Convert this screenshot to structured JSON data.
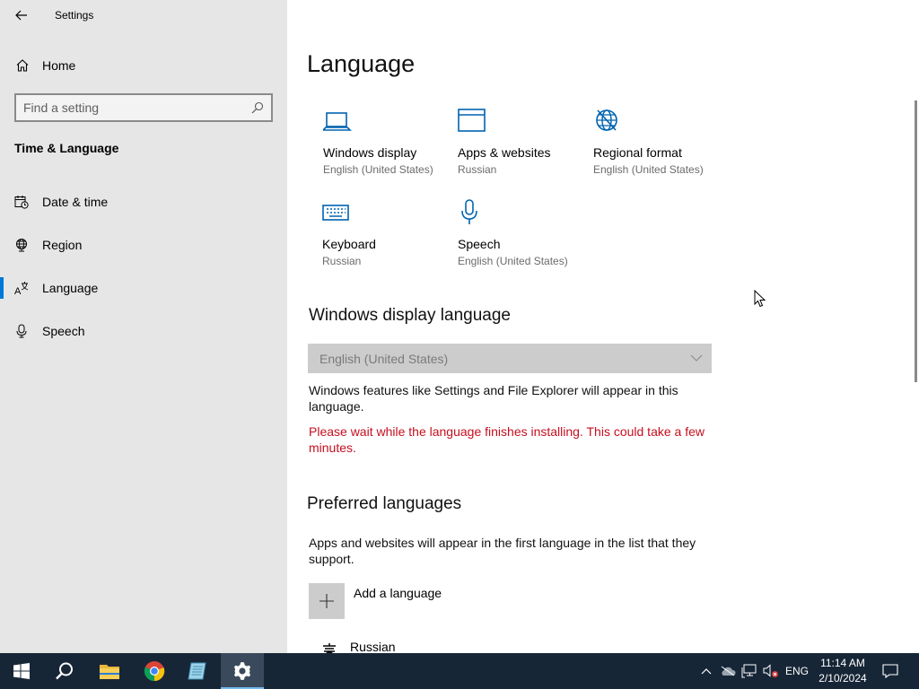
{
  "window": {
    "title": "Settings"
  },
  "sidebar": {
    "home_label": "Home",
    "search_placeholder": "Find a setting",
    "section_title": "Time & Language",
    "items": [
      {
        "label": "Date & time",
        "icon": "calendar-clock-icon"
      },
      {
        "label": "Region",
        "icon": "globe-icon"
      },
      {
        "label": "Language",
        "icon": "language-icon",
        "active": true
      },
      {
        "label": "Speech",
        "icon": "microphone-icon"
      }
    ]
  },
  "main": {
    "title": "Language",
    "tiles": [
      {
        "label": "Windows display",
        "sub": "English (United States)",
        "icon": "laptop-icon"
      },
      {
        "label": "Apps & websites",
        "sub": "Russian",
        "icon": "browser-window-icon"
      },
      {
        "label": "Regional format",
        "sub": "English (United States)",
        "icon": "regional-format-icon"
      },
      {
        "label": "Keyboard",
        "sub": "Russian",
        "icon": "keyboard-icon"
      },
      {
        "label": "Speech",
        "sub": "English (United States)",
        "icon": "microphone-icon"
      }
    ],
    "display_language": {
      "heading": "Windows display language",
      "selected": "English (United States)",
      "description": "Windows features like Settings and File Explorer will appear in this language.",
      "warning": "Please wait while the language finishes installing. This could take a few minutes."
    },
    "preferred": {
      "heading": "Preferred languages",
      "description": "Apps and websites will appear in the first language in the list that they support.",
      "add_label": "Add a language",
      "languages": [
        {
          "label": "Russian",
          "icon": "language-glyph-icon"
        }
      ]
    }
  },
  "taskbar": {
    "apps": [
      {
        "name": "start-button",
        "icon": "windows-logo-icon"
      },
      {
        "name": "search-button",
        "icon": "search-icon"
      },
      {
        "name": "file-explorer-button",
        "icon": "folder-icon"
      },
      {
        "name": "chrome-button",
        "icon": "chrome-icon"
      },
      {
        "name": "notepad-button",
        "icon": "notepad-icon"
      },
      {
        "name": "settings-button",
        "icon": "gear-icon",
        "active": true
      }
    ],
    "lang_indicator": "ENG",
    "time": "11:14 AM",
    "date": "2/10/2024"
  },
  "colors": {
    "accent": "#0078d7",
    "sidebar_bg": "#e6e6e6",
    "warning": "#c50f1f",
    "taskbar_bg": "#172637",
    "icon_blue": "#0063b1"
  }
}
